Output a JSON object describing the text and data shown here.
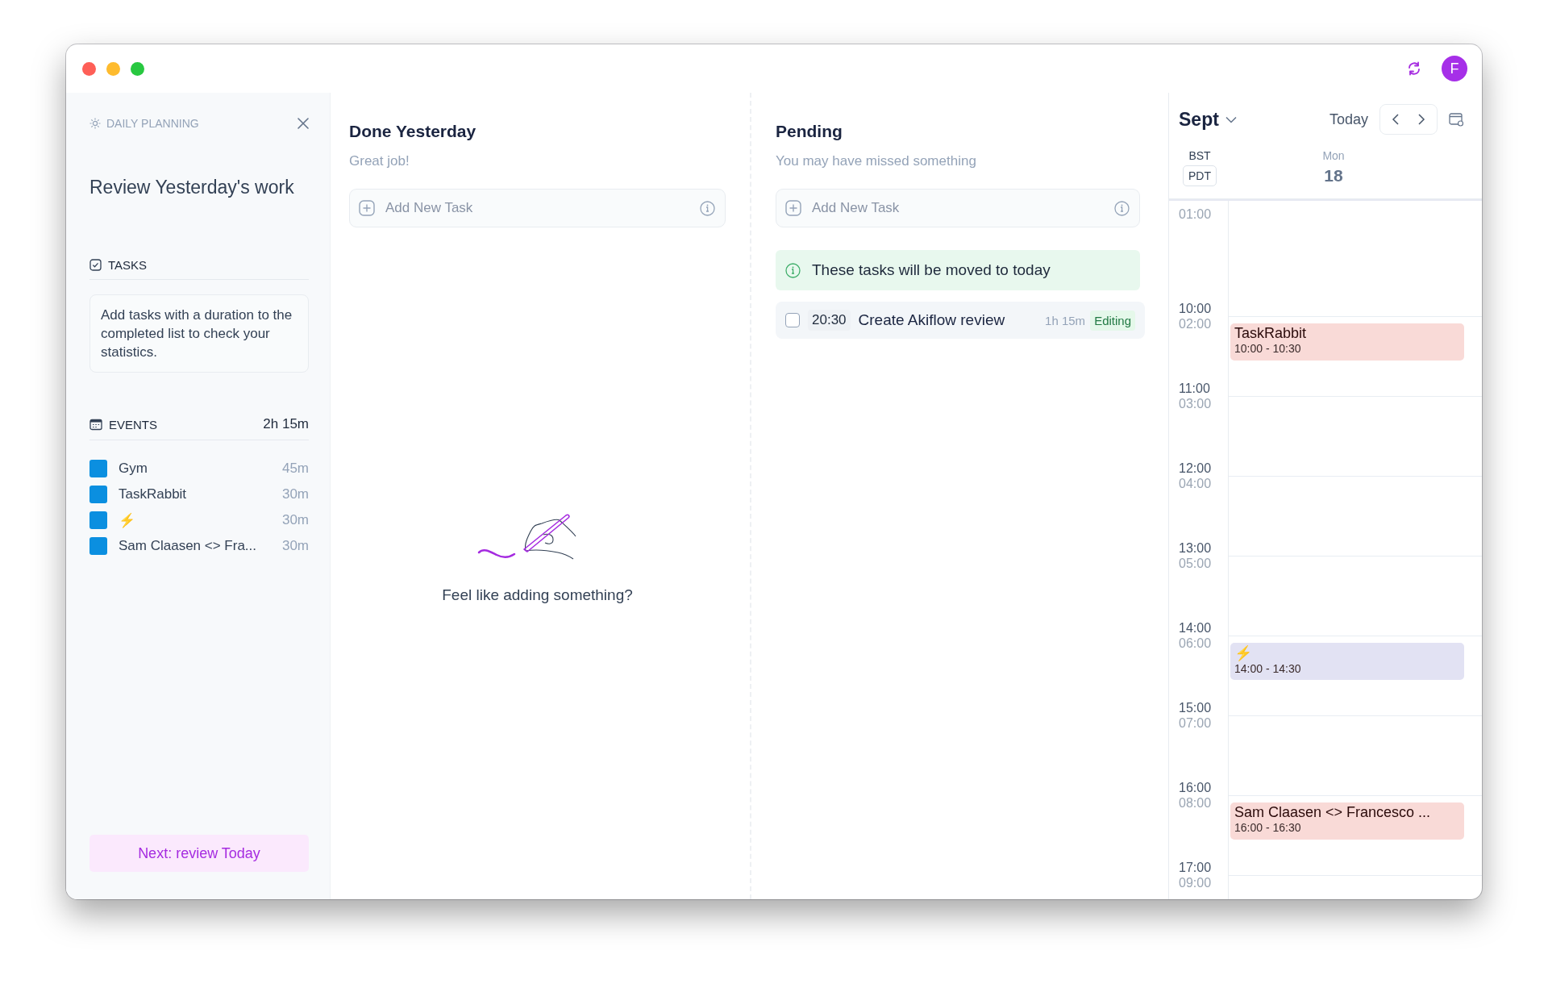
{
  "sidebar": {
    "label": "DAILY PLANNING",
    "title": "Review Yesterday's work",
    "tasks": {
      "label": "TASKS",
      "hint": "Add tasks with a duration to the completed list to check your statistics."
    },
    "events": {
      "label": "EVENTS",
      "total": "2h 15m",
      "items": [
        {
          "name": "Gym",
          "duration": "45m"
        },
        {
          "name": "TaskRabbit",
          "duration": "30m"
        },
        {
          "name": "⚡",
          "duration": "30m"
        },
        {
          "name": "Sam Claasen <> Fra...",
          "duration": "30m"
        }
      ]
    },
    "next_button": "Next: review Today"
  },
  "columns": [
    {
      "title": "Done Yesterday",
      "subtitle": "Great job!",
      "add_field": {
        "placeholder": "Add New Task"
      },
      "empty": {
        "text": "Feel like adding something?"
      }
    },
    {
      "title": "Pending",
      "subtitle": "You may have missed something",
      "add_field": {
        "placeholder": "Add New Task"
      },
      "notice": "These tasks will be moved to today",
      "tasks": [
        {
          "checked": false,
          "time": "20:30",
          "title": "Create Akiflow review",
          "duration": "1h 15m",
          "badge": "Editing"
        }
      ]
    }
  ],
  "topbar": {
    "avatar": "F"
  },
  "calendar": {
    "month": "Sept",
    "today": "Today",
    "zones": [
      "BST",
      "PDT"
    ],
    "day": {
      "weekday": "Mon",
      "date": "18"
    },
    "slots": [
      {
        "secondary": "01:00"
      },
      {
        "primary": "10:00",
        "secondary": "02:00",
        "events": [
          {
            "title": "TaskRabbit",
            "time": "10:00 - 10:30",
            "color": "#f9dad7"
          }
        ]
      },
      {
        "primary": "11:00",
        "secondary": "03:00"
      },
      {
        "primary": "12:00",
        "secondary": "04:00"
      },
      {
        "primary": "13:00",
        "secondary": "05:00"
      },
      {
        "primary": "14:00",
        "secondary": "06:00",
        "events": [
          {
            "title": "⚡",
            "time": "14:00 - 14:30",
            "color": "#e2e2f3"
          }
        ]
      },
      {
        "primary": "15:00",
        "secondary": "07:00"
      },
      {
        "primary": "16:00",
        "secondary": "08:00",
        "events": [
          {
            "title": "Sam Claasen <> Francesco ...",
            "time": "16:00 - 16:30",
            "color": "#f9dad7"
          }
        ]
      },
      {
        "primary": "17:00",
        "secondary": "09:00"
      }
    ]
  }
}
